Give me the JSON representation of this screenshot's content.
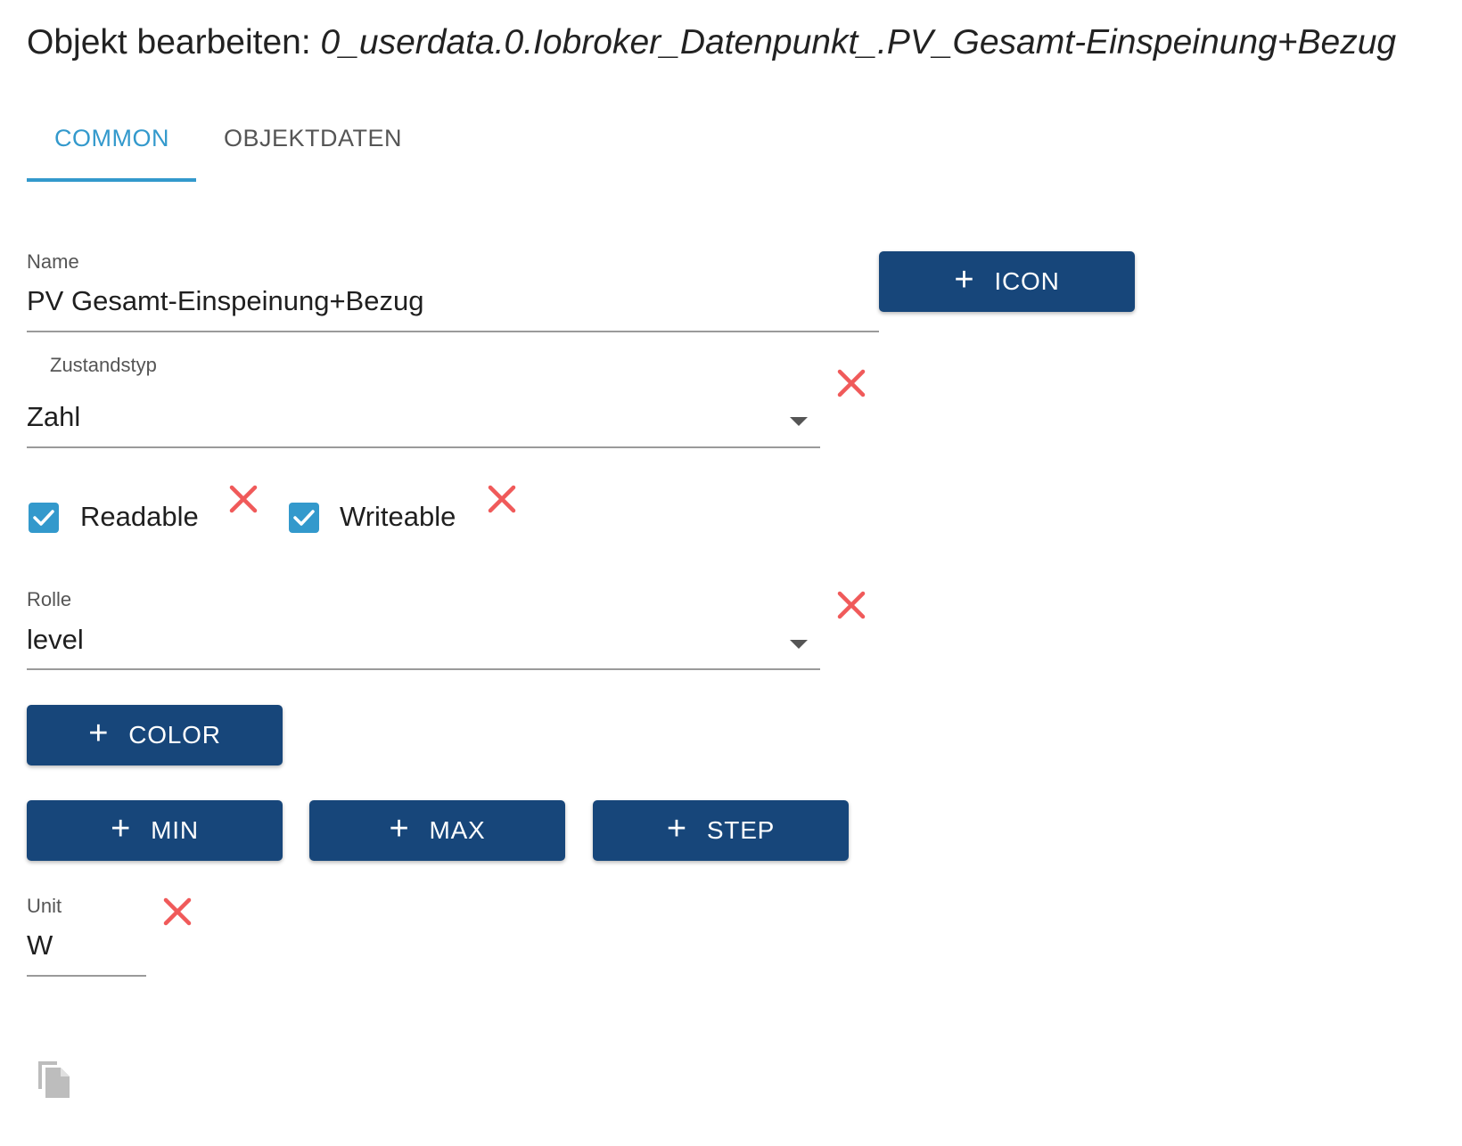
{
  "header": {
    "title_prefix": "Objekt bearbeiten: ",
    "object_id": "0_userdata.0.Iobroker_Datenpunkt_.PV_Gesamt-Einspeinung+Bezug"
  },
  "tabs": [
    {
      "label": "COMMON",
      "active": true
    },
    {
      "label": "OBJEKTDATEN",
      "active": false
    }
  ],
  "form": {
    "name": {
      "label": "Name",
      "value": "PV Gesamt-Einspeinung+Bezug"
    },
    "icon_button": {
      "label": "ICON",
      "icon": "plus-icon"
    },
    "state_type": {
      "label": "Zustandstyp",
      "value": "Zahl"
    },
    "readable": {
      "label": "Readable",
      "checked": true
    },
    "writeable": {
      "label": "Writeable",
      "checked": true
    },
    "role": {
      "label": "Rolle",
      "value": "level"
    },
    "color_button": {
      "label": "COLOR",
      "icon": "plus-icon"
    },
    "min_button": {
      "label": "MIN",
      "icon": "plus-icon"
    },
    "max_button": {
      "label": "MAX",
      "icon": "plus-icon"
    },
    "step_button": {
      "label": "STEP",
      "icon": "plus-icon"
    },
    "unit": {
      "label": "Unit",
      "value": "W"
    }
  },
  "colors": {
    "accent": "#3399cc",
    "button_bg": "#17467a",
    "delete_red": "#f05a5a"
  },
  "icons": {
    "delete": "close-icon",
    "dropdown": "chevron-down-icon",
    "copy": "copy-icon",
    "checkbox": "check-icon"
  }
}
